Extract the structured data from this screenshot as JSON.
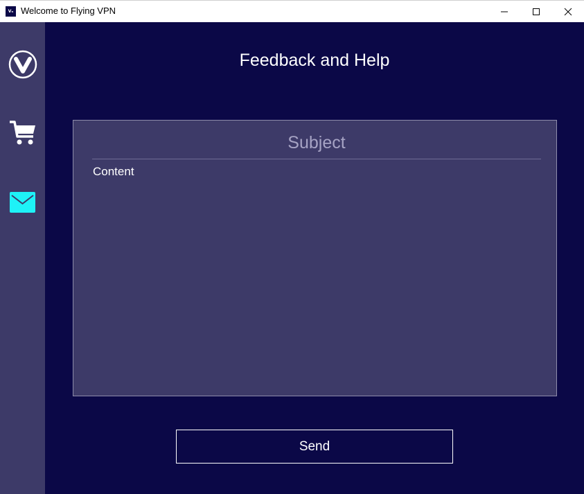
{
  "window": {
    "title": "Welcome to Flying VPN",
    "app_icon_text": "Vₙ"
  },
  "sidebar": {
    "items": [
      {
        "name": "vpn",
        "icon": "vpn-logo-icon",
        "active": false
      },
      {
        "name": "store",
        "icon": "shopping-cart-icon",
        "active": false
      },
      {
        "name": "feedback",
        "icon": "mail-icon",
        "active": true
      }
    ]
  },
  "main": {
    "title": "Feedback and Help",
    "subject_placeholder": "Subject",
    "content_placeholder": "Content",
    "send_label": "Send"
  },
  "colors": {
    "background": "#0b0847",
    "sidebar": "#3d3a68",
    "panel": "#3d3a68",
    "active_icon": "#1ef2f7"
  }
}
